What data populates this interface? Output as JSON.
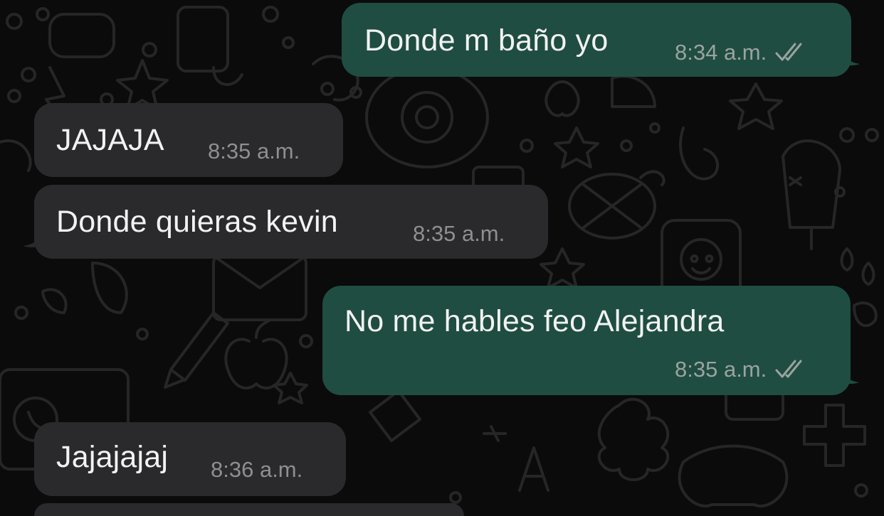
{
  "messages": [
    {
      "direction": "outgoing",
      "text": "Donde m baño yo",
      "time": "8:34 a.m.",
      "status": "read-double-check-icon"
    },
    {
      "direction": "incoming",
      "text": "JAJAJA",
      "time": "8:35 a.m."
    },
    {
      "direction": "incoming",
      "text": "Donde quieras kevin",
      "time": "8:35 a.m."
    },
    {
      "direction": "outgoing",
      "text": "No me hables feo Alejandra",
      "time": "8:35 a.m.",
      "status": "read-double-check-icon"
    },
    {
      "direction": "incoming",
      "text": "Jajajajaj",
      "time": "8:36 a.m."
    }
  ],
  "colors": {
    "background": "#0b0b0b",
    "outgoing_bubble": "#1f4d41",
    "incoming_bubble": "#2a2a2c",
    "doodle_stroke": "#262626",
    "timestamp": "#9aa39f"
  }
}
